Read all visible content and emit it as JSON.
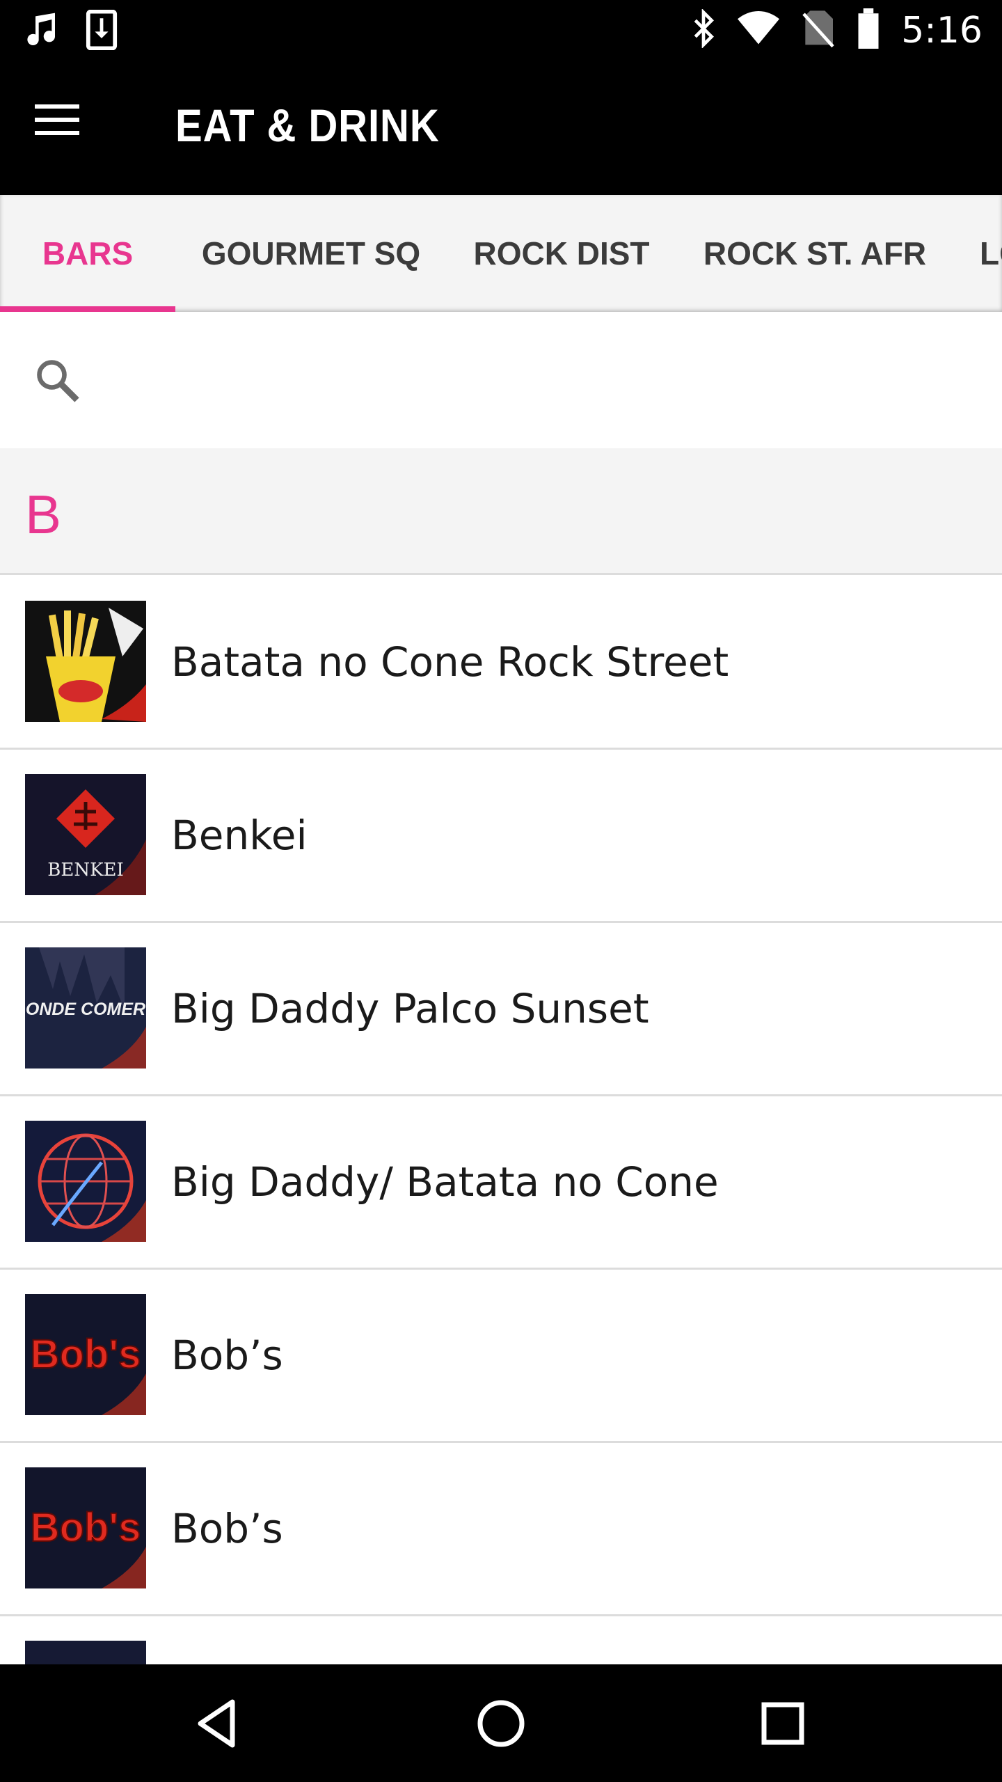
{
  "status_bar": {
    "time": "5:16",
    "icons_left": [
      "music-note-icon",
      "download-icon"
    ],
    "icons_right": [
      "bluetooth-icon",
      "wifi-icon",
      "no-sim-icon",
      "battery-icon"
    ]
  },
  "app_bar": {
    "title": "EAT & DRINK",
    "menu_icon": "hamburger-menu-icon"
  },
  "tabs": [
    {
      "label": "BARS",
      "active": true
    },
    {
      "label": "GOURMET SQ",
      "active": false
    },
    {
      "label": "ROCK DIST",
      "active": false
    },
    {
      "label": "ROCK ST. AFR",
      "active": false
    },
    {
      "label": "LO",
      "active": false
    }
  ],
  "search": {
    "icon": "search-icon",
    "placeholder": ""
  },
  "section": {
    "letter": "B"
  },
  "items": [
    {
      "name": "Batata no Cone Rock Street",
      "thumb": "fries-cone-thumbnail"
    },
    {
      "name": "Benkei",
      "thumb": "benkei-logo-thumbnail",
      "thumb_text": "BENKEI"
    },
    {
      "name": "Big Daddy Palco Sunset",
      "thumb": "onde-comer-thumbnail",
      "thumb_text": "ONDE COMER"
    },
    {
      "name": "Big Daddy/ Batata no Cone",
      "thumb": "rock-globe-thumbnail"
    },
    {
      "name": "Bob’s",
      "thumb": "bobs-logo-thumbnail",
      "thumb_text": "Bob's"
    },
    {
      "name": "Bob’s",
      "thumb": "bobs-logo-thumbnail",
      "thumb_text": "Bob's"
    },
    {
      "name": "",
      "thumb": "partial-thumbnail"
    }
  ],
  "nav_bar": {
    "back": "back-triangle-icon",
    "home": "home-circle-icon",
    "recents": "recents-square-icon"
  },
  "colors": {
    "accent": "#e8368f",
    "bar_background": "#000000",
    "tab_background": "#f4f4f4",
    "divider": "#dcdcdc"
  }
}
